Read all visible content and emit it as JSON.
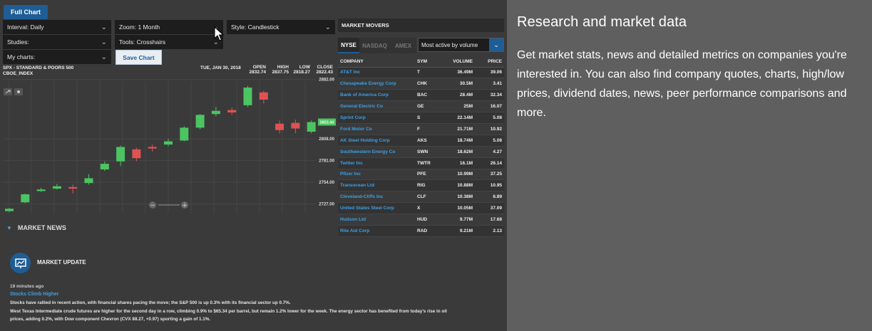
{
  "toolbar": {
    "full_chart": "Full Chart",
    "interval": "Interval: Daily",
    "zoom": "Zoom: 1 Month",
    "style": "Style: Candlestick",
    "studies": "Studies:",
    "tools": "Tools: Crosshairs",
    "my_charts": "My charts:",
    "save_chart": "Save Chart"
  },
  "chart": {
    "symbol": "SPX - STANDARD & POORS 500",
    "exchange": "CBOE_INDEX",
    "date": "TUE, JAN 30, 2018",
    "open_label": "OPEN",
    "open": "2832.74",
    "high_label": "HIGH",
    "high": "2837.75",
    "low_label": "LOW",
    "low": "2818.27",
    "close_label": "CLOSE",
    "close": "2822.43",
    "y_ticks": [
      "2882.00",
      "2808.00",
      "2781.00",
      "2754.00",
      "2727.00"
    ],
    "current_price": "2822.43",
    "colors": {
      "up": "#4cc461",
      "down": "#e05252",
      "bg": "#3a3a3a"
    }
  },
  "chart_data": {
    "type": "candlestick",
    "title": "SPX - STANDARD & POORS 500",
    "ylim": [
      2715,
      2880
    ],
    "yticks": [
      2882.0,
      2808.0,
      2781.0,
      2754.0,
      2727.0
    ],
    "candles": [
      {
        "o": 2718,
        "c": 2721,
        "h": 2722,
        "l": 2717
      },
      {
        "o": 2729,
        "c": 2739,
        "h": 2740,
        "l": 2728
      },
      {
        "o": 2743,
        "c": 2745,
        "h": 2747,
        "l": 2742
      },
      {
        "o": 2746,
        "c": 2749,
        "h": 2752,
        "l": 2745
      },
      {
        "o": 2748,
        "c": 2746,
        "h": 2751,
        "l": 2740
      },
      {
        "o": 2753,
        "c": 2759,
        "h": 2764,
        "l": 2751
      },
      {
        "o": 2770,
        "c": 2777,
        "h": 2780,
        "l": 2768
      },
      {
        "o": 2780,
        "c": 2798,
        "h": 2800,
        "l": 2774
      },
      {
        "o": 2795,
        "c": 2784,
        "h": 2797,
        "l": 2780
      },
      {
        "o": 2798,
        "c": 2796,
        "h": 2801,
        "l": 2792
      },
      {
        "o": 2801,
        "c": 2805,
        "h": 2808,
        "l": 2799
      },
      {
        "o": 2806,
        "c": 2822,
        "h": 2824,
        "l": 2805
      },
      {
        "o": 2822,
        "c": 2838,
        "h": 2839,
        "l": 2820
      },
      {
        "o": 2839,
        "c": 2843,
        "h": 2848,
        "l": 2836
      },
      {
        "o": 2844,
        "c": 2841,
        "h": 2847,
        "l": 2838
      },
      {
        "o": 2850,
        "c": 2872,
        "h": 2874,
        "l": 2848
      },
      {
        "o": 2866,
        "c": 2857,
        "h": 2868,
        "l": 2852
      },
      {
        "o": 2827,
        "c": 2819,
        "h": 2831,
        "l": 2815
      },
      {
        "o": 2828,
        "c": 2821,
        "h": 2832,
        "l": 2815
      },
      {
        "o": 2817,
        "c": 2829,
        "h": 2831,
        "l": 2815
      }
    ]
  },
  "movers": {
    "title": "MARKET MOVERS",
    "tabs": [
      "NYSE",
      "NASDAQ",
      "AMEX"
    ],
    "select": "Most active by volume",
    "headers": [
      "COMPANY",
      "SYM",
      "VOLUME",
      "PRICE"
    ],
    "rows": [
      [
        "AT&T Inc",
        "T",
        "36.49M",
        "39.06"
      ],
      [
        "Chesapeake Energy Corp",
        "CHK",
        "30.5M",
        "3.41"
      ],
      [
        "Bank of America Corp",
        "BAC",
        "28.4M",
        "32.34"
      ],
      [
        "General Electric Co",
        "GE",
        "25M",
        "16.07"
      ],
      [
        "Sprint Corp",
        "S",
        "22.14M",
        "5.08"
      ],
      [
        "Ford Motor Co",
        "F",
        "21.71M",
        "10.92"
      ],
      [
        "AK Steel Holding Corp",
        "AKS",
        "18.74M",
        "5.08"
      ],
      [
        "Southwestern Energy Co",
        "SWN",
        "18.62M",
        "4.27"
      ],
      [
        "Twitter Inc",
        "TWTR",
        "16.1M",
        "26.14"
      ],
      [
        "Pfizer Inc",
        "PFE",
        "10.99M",
        "37.25"
      ],
      [
        "Transocean Ltd",
        "RIG",
        "10.88M",
        "10.95"
      ],
      [
        "Cleveland-Cliffs Inc",
        "CLF",
        "10.38M",
        "6.89"
      ],
      [
        "United States Steel Corp",
        "X",
        "10.05M",
        "37.09"
      ],
      [
        "Hudson Ltd",
        "HUD",
        "9.77M",
        "17.68"
      ],
      [
        "Rite Aid Corp",
        "RAD",
        "9.21M",
        "2.13"
      ]
    ]
  },
  "news": {
    "heading": "MARKET NEWS",
    "update_title": "MARKET UPDATE",
    "time": "19 minutes ago",
    "headline": "Stocks Climb Higher",
    "line1": "Stocks have rallied in recent action, with financial shares pacing the move; the S&P 500 is up 0.3% with its financial sector up 0.7%.",
    "line2": "West Texas Intermediate crude futures are higher for the second day in a row, climbing 0.9% to $65.34 per barrel, but remain 1.2% lower for the week. The energy sector has benefited from today's rise in oil",
    "line3": "prices, adding 0.2%, with Dow component Chevron (CVX 88.27, +0.97) sporting a gain of 1.1%."
  },
  "side": {
    "heading": "Research and market data",
    "body": "Get market stats, news and detailed metrics on companies you're interested in. You can also find company quotes, charts, high/low prices, dividend dates, news, peer performance comparisons and more."
  }
}
